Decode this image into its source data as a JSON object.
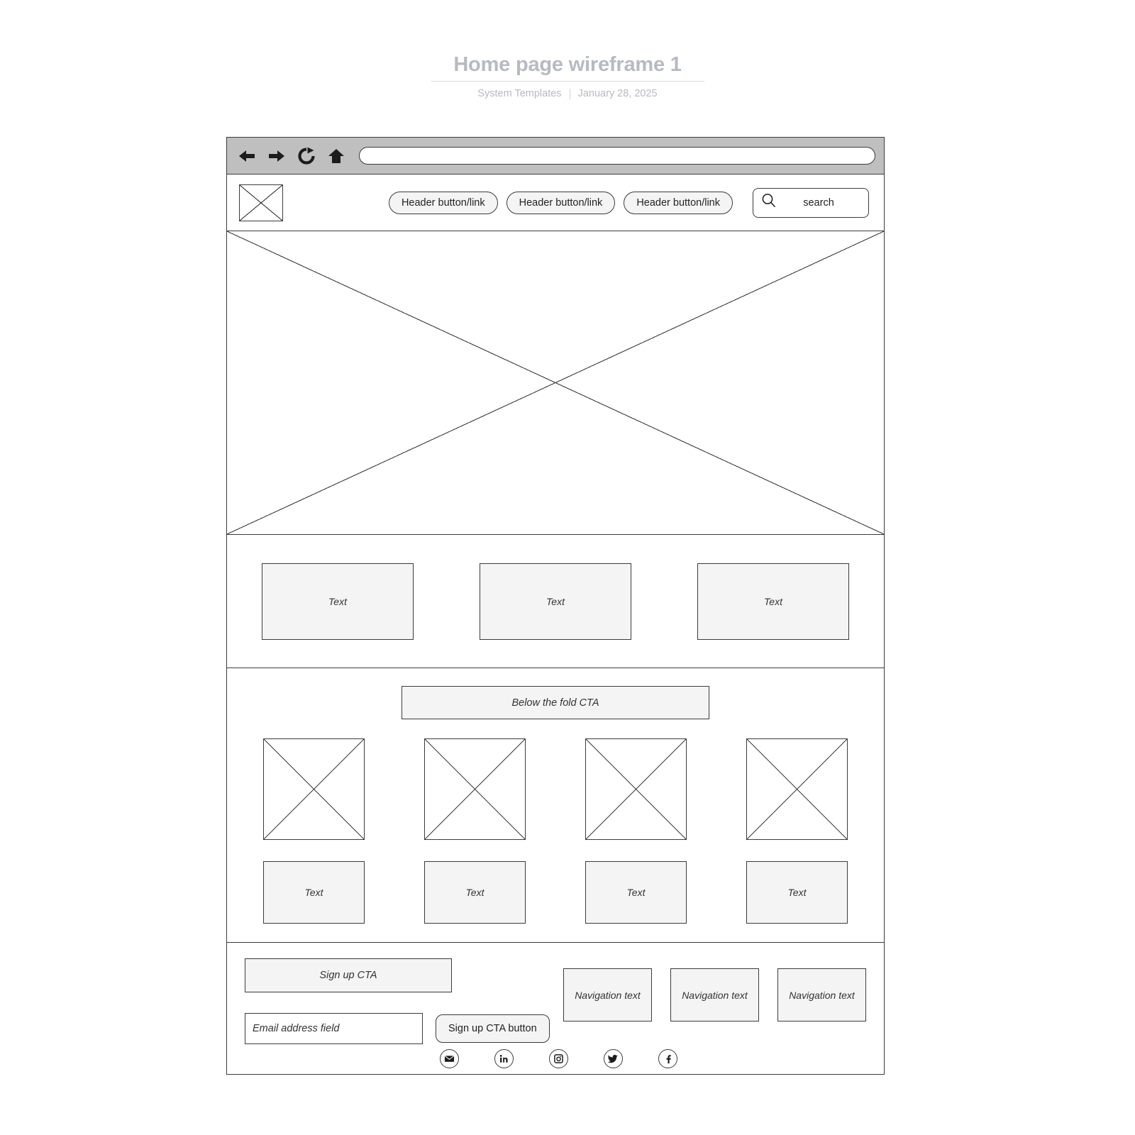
{
  "document": {
    "title": "Home page wireframe 1",
    "author": "System Templates",
    "date": "January 28, 2025"
  },
  "browser_chrome": {
    "back_icon": "arrow-left-icon",
    "forward_icon": "arrow-right-icon",
    "reload_icon": "reload-icon",
    "home_icon": "home-icon",
    "url_value": "",
    "url_placeholder": ""
  },
  "site_header": {
    "logo_alt": "logo-placeholder",
    "buttons": [
      {
        "label": "Header button/link"
      },
      {
        "label": "Header button/link"
      },
      {
        "label": "Header button/link"
      }
    ],
    "search": {
      "icon": "search-icon",
      "label": "search",
      "placeholder": "search"
    }
  },
  "hero": {
    "image_alt": "hero-image-placeholder"
  },
  "feature_row": {
    "tiles": [
      {
        "label": "Text"
      },
      {
        "label": "Text"
      },
      {
        "label": "Text"
      }
    ]
  },
  "cta_section": {
    "headline": "Below the fold CTA",
    "cards": [
      {
        "image_alt": "image-placeholder",
        "label": "Text"
      },
      {
        "image_alt": "image-placeholder",
        "label": "Text"
      },
      {
        "image_alt": "image-placeholder",
        "label": "Text"
      },
      {
        "image_alt": "image-placeholder",
        "label": "Text"
      }
    ]
  },
  "footer": {
    "signup_cta": "Sign up CTA",
    "email_field_value": "",
    "email_field_placeholder": "Email address field",
    "email_field_label": "Email address field",
    "signup_button": "Sign up CTA button",
    "nav_tiles": [
      {
        "label": "Navigation text"
      },
      {
        "label": "Navigation text"
      },
      {
        "label": "Navigation text"
      }
    ],
    "social": [
      {
        "name": "email-icon"
      },
      {
        "name": "linkedin-icon"
      },
      {
        "name": "instagram-icon"
      },
      {
        "name": "twitter-icon"
      },
      {
        "name": "facebook-icon"
      }
    ]
  },
  "colors": {
    "title_gray": "#b6bac2",
    "chrome_gray": "#bfbfbf",
    "tile_fill": "#f4f4f4",
    "stroke": "#3b3b3b"
  }
}
